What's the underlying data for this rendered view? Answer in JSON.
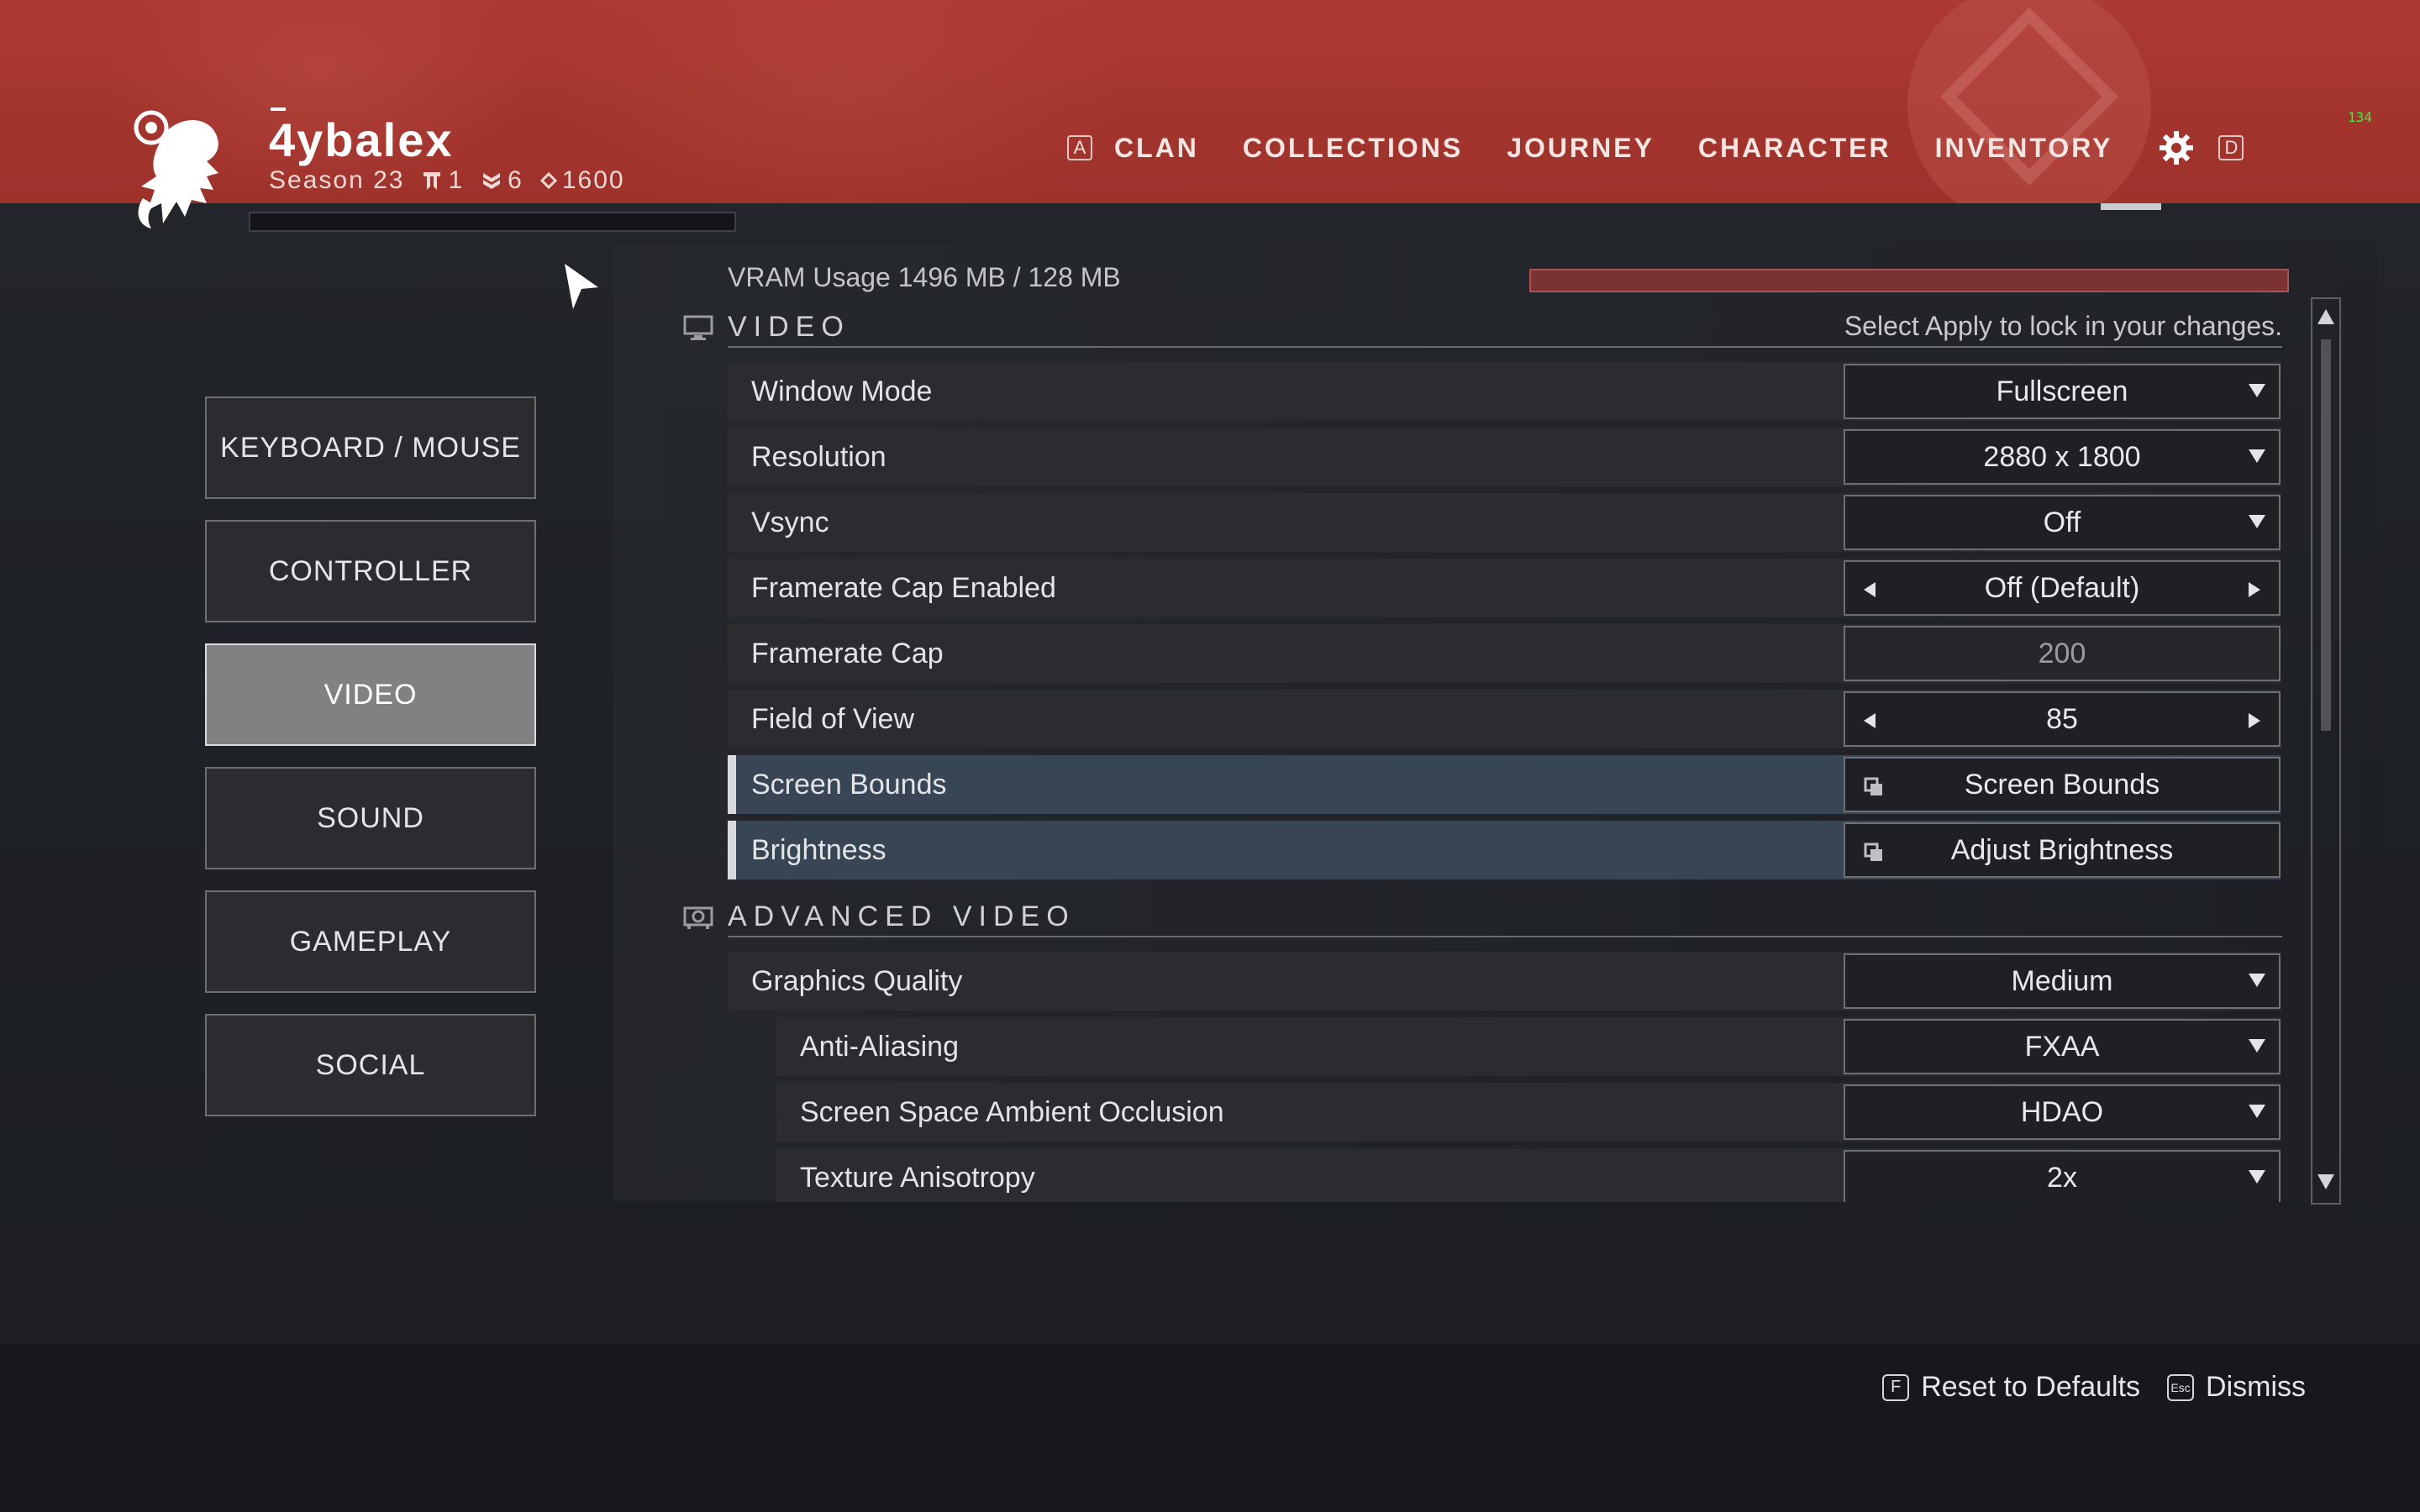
{
  "header": {
    "username": "4ybalex",
    "season": "Season 23",
    "stat_clan": "1",
    "stat_triumph": "6",
    "stat_power": "1600",
    "nav_key_left": "A",
    "nav_key_right": "D",
    "tabs": [
      "CLAN",
      "COLLECTIONS",
      "JOURNEY",
      "CHARACTER",
      "INVENTORY"
    ],
    "fps": "134"
  },
  "sidebar": {
    "items": [
      "KEYBOARD / MOUSE",
      "CONTROLLER",
      "VIDEO",
      "SOUND",
      "GAMEPLAY",
      "SOCIAL"
    ],
    "active": "VIDEO"
  },
  "main": {
    "vram_label": "VRAM Usage 1496 MB / 128 MB",
    "hint": "Select Apply to lock in your changes.",
    "video_section": "VIDEO",
    "advanced_section": "ADVANCED VIDEO",
    "rows": [
      {
        "label": "Window Mode",
        "value": "Fullscreen"
      },
      {
        "label": "Resolution",
        "value": "2880 x 1800"
      },
      {
        "label": "Vsync",
        "value": "Off"
      },
      {
        "label": "Framerate Cap Enabled",
        "value": "Off (Default)"
      },
      {
        "label": "Framerate Cap",
        "value": "200"
      },
      {
        "label": "Field of View",
        "value": "85"
      },
      {
        "label": "Screen Bounds",
        "value": "Screen Bounds"
      },
      {
        "label": "Brightness",
        "value": "Adjust Brightness"
      }
    ],
    "advanced_rows": [
      {
        "label": "Graphics Quality",
        "value": "Medium"
      },
      {
        "label": "Anti-Aliasing",
        "value": "FXAA"
      },
      {
        "label": "Screen Space Ambient Occlusion",
        "value": "HDAO"
      },
      {
        "label": "Texture Anisotropy",
        "value": "2x"
      }
    ]
  },
  "footer": {
    "reset_key": "F",
    "reset_label": "Reset to Defaults",
    "dismiss_key": "Esc",
    "dismiss_label": "Dismiss"
  },
  "colors": {
    "header_red": "#a2342d",
    "highlight_row": "#384554",
    "vram_bar": "#7a3233",
    "active_tab": "#808183"
  }
}
